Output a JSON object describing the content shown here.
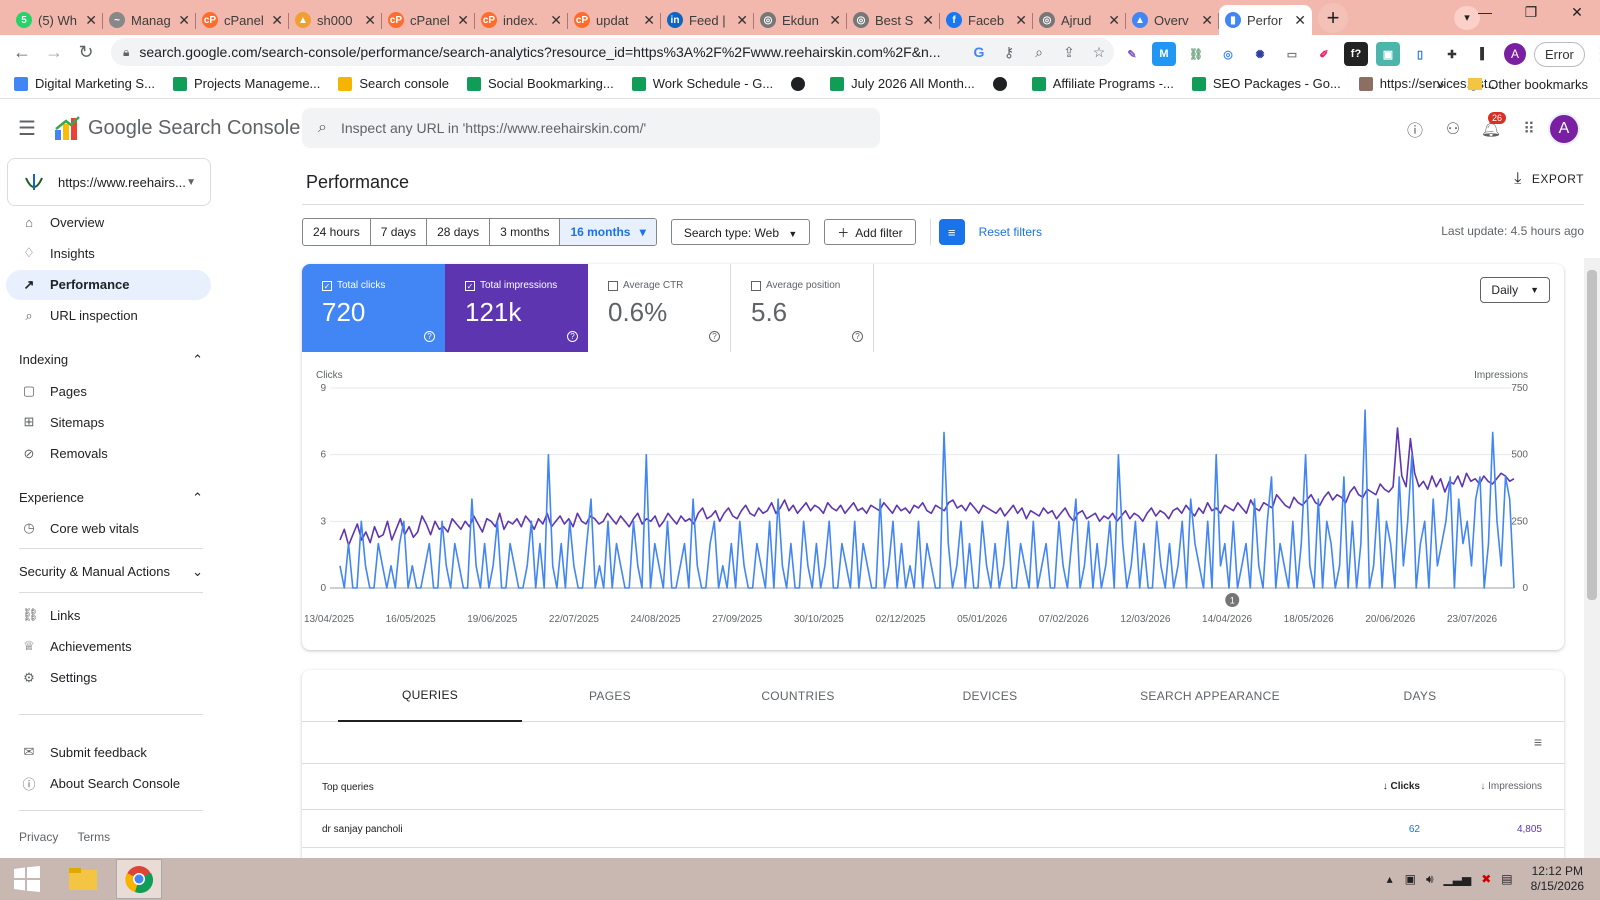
{
  "browser": {
    "tabs": [
      {
        "label": "(5) Wh",
        "color": "#25d366",
        "glyph": "5"
      },
      {
        "label": "Manag",
        "color": "#888888",
        "glyph": "~"
      },
      {
        "label": "cPanel",
        "color": "#ff6c2c",
        "glyph": "cP"
      },
      {
        "label": "sh000",
        "color": "#f0a030",
        "glyph": "▲"
      },
      {
        "label": "cPanel",
        "color": "#ff6c2c",
        "glyph": "cP"
      },
      {
        "label": "index.",
        "color": "#ff6c2c",
        "glyph": "cP"
      },
      {
        "label": "updat",
        "color": "#ff6c2c",
        "glyph": "cP"
      },
      {
        "label": "Feed |",
        "color": "#0a66c2",
        "glyph": "in"
      },
      {
        "label": "Ekdun",
        "color": "#777777",
        "glyph": "◎"
      },
      {
        "label": "Best S",
        "color": "#777777",
        "glyph": "◎"
      },
      {
        "label": "Faceb",
        "color": "#1877f2",
        "glyph": "f"
      },
      {
        "label": "Ajrud",
        "color": "#777777",
        "glyph": "◎"
      },
      {
        "label": "Overv",
        "color": "#4285f4",
        "glyph": "▲"
      },
      {
        "label": "Perfor",
        "color": "#4285f4",
        "glyph": "▮",
        "active": true
      }
    ],
    "url": "search.google.com/search-console/performance/search-analytics?resource_id=https%3A%2F%2Fwww.reehairskin.com%2F&n...",
    "error_label": "Error",
    "profile_letter": "A",
    "bookmarks": [
      {
        "label": "Digital Marketing S...",
        "color": "#4285f4"
      },
      {
        "label": "Projects Manageme...",
        "color": "#0f9d58"
      },
      {
        "label": "Search console",
        "color": "#f4b400"
      },
      {
        "label": "Social Bookmarking...",
        "color": "#0f9d58"
      },
      {
        "label": "Work Schedule - G...",
        "color": "#0f9d58"
      },
      {
        "label": "",
        "color": "#202124"
      },
      {
        "label": "July 2026 All Month...",
        "color": "#0f9d58"
      },
      {
        "label": "",
        "color": "#202124"
      },
      {
        "label": "Affiliate Programs -...",
        "color": "#0f9d58"
      },
      {
        "label": "SEO Packages - Go...",
        "color": "#0f9d58"
      },
      {
        "label": "https://services.gst...",
        "color": "#8d6e63"
      }
    ],
    "other_bookmarks": "Other bookmarks"
  },
  "app": {
    "name": "Google Search Console",
    "search_placeholder": "Inspect any URL in 'https://www.reehairskin.com/'",
    "notification_count": "26",
    "avatar_letter": "A"
  },
  "sidebar": {
    "property": "https://www.reehairs...",
    "items_top": [
      {
        "label": "Overview",
        "icon": "⌂"
      },
      {
        "label": "Insights",
        "icon": "♢"
      },
      {
        "label": "Performance",
        "icon": "↗",
        "active": true
      },
      {
        "label": "URL inspection",
        "icon": "⌕"
      }
    ],
    "indexing_label": "Indexing",
    "indexing_items": [
      {
        "label": "Pages",
        "icon": "▢"
      },
      {
        "label": "Sitemaps",
        "icon": "⊞"
      },
      {
        "label": "Removals",
        "icon": "⊘"
      }
    ],
    "experience_label": "Experience",
    "experience_items": [
      {
        "label": "Core web vitals",
        "icon": "◷"
      }
    ],
    "security_label": "Security & Manual Actions",
    "other_items": [
      {
        "label": "Links",
        "icon": "⛓"
      },
      {
        "label": "Achievements",
        "icon": "♕"
      },
      {
        "label": "Settings",
        "icon": "⚙"
      }
    ],
    "bottom_items": [
      {
        "label": "Submit feedback",
        "icon": "✉"
      },
      {
        "label": "About Search Console",
        "icon": "ⓘ"
      }
    ],
    "privacy": "Privacy",
    "terms": "Terms"
  },
  "performance": {
    "title": "Performance",
    "export": "EXPORT",
    "date_ranges": [
      "24 hours",
      "7 days",
      "28 days",
      "3 months",
      "16 months"
    ],
    "selected_range": "16 months",
    "search_type": "Search type: Web",
    "add_filter": "Add filter",
    "reset_filters": "Reset filters",
    "last_update": "Last update: 4.5 hours ago",
    "metrics": [
      {
        "label": "Total clicks",
        "value": "720",
        "checked": true
      },
      {
        "label": "Total impressions",
        "value": "121k",
        "checked": true
      },
      {
        "label": "Average CTR",
        "value": "0.6%",
        "checked": false
      },
      {
        "label": "Average position",
        "value": "5.6",
        "checked": false
      }
    ],
    "granularity": "Daily"
  },
  "chart_data": {
    "type": "line",
    "left_axis_label": "Clicks",
    "right_axis_label": "Impressions",
    "left_ticks": [
      "9",
      "6",
      "3",
      "0"
    ],
    "right_ticks": [
      "750",
      "500",
      "250",
      "0"
    ],
    "ylim_left": [
      0,
      9
    ],
    "ylim_right": [
      0,
      750
    ],
    "x_tick_labels": [
      "13/04/2025",
      "16/05/2025",
      "19/06/2025",
      "22/07/2025",
      "24/08/2025",
      "27/09/2025",
      "30/10/2025",
      "02/12/2025",
      "05/01/2026",
      "07/02/2026",
      "12/03/2026",
      "14/04/2026",
      "18/05/2026",
      "20/06/2026",
      "23/07/2026"
    ],
    "annotation_label": "1",
    "series": [
      {
        "name": "Clicks",
        "color": "#4285f4",
        "axis": "left",
        "values": [
          1,
          0,
          2,
          0,
          0,
          3,
          1,
          0,
          0,
          2,
          1,
          0,
          1,
          0,
          2,
          3,
          0,
          1,
          0,
          0,
          1,
          2,
          0,
          0,
          3,
          1,
          0,
          2,
          1,
          0,
          0,
          4,
          1,
          0,
          2,
          0,
          1,
          3,
          0,
          0,
          2,
          1,
          0,
          0,
          1,
          3,
          0,
          2,
          0,
          6,
          1,
          0,
          2,
          0,
          3,
          1,
          0,
          0,
          2,
          4,
          0,
          1,
          0,
          3,
          0,
          2,
          1,
          0,
          0,
          3,
          1,
          0,
          6,
          0,
          2,
          1,
          0,
          3,
          0,
          0,
          1,
          2,
          0,
          4,
          1,
          0,
          0,
          2,
          3,
          0,
          1,
          0,
          2,
          0,
          3,
          1,
          0,
          0,
          2,
          1,
          0,
          3,
          0,
          4,
          1,
          0,
          2,
          0,
          0,
          3,
          1,
          0,
          2,
          0,
          1,
          3,
          0,
          0,
          2,
          1,
          0,
          3,
          0,
          2,
          1,
          0,
          0,
          4,
          0,
          1,
          3,
          0,
          2,
          0,
          1,
          0,
          3,
          0,
          2,
          1,
          0,
          0,
          7,
          2,
          0,
          1,
          3,
          0,
          2,
          0,
          0,
          3,
          1,
          0,
          2,
          0,
          1,
          3,
          0,
          0,
          2,
          1,
          0,
          3,
          0,
          1,
          2,
          0,
          0,
          3,
          1,
          0,
          2,
          4,
          0,
          1,
          3,
          0,
          2,
          0,
          1,
          3,
          0,
          6,
          2,
          0,
          1,
          3,
          0,
          2,
          0,
          0,
          3,
          1,
          0,
          2,
          0,
          1,
          3,
          0,
          4,
          2,
          1,
          0,
          3,
          0,
          6,
          1,
          2,
          0,
          3,
          0,
          1,
          2,
          0,
          4,
          1,
          0,
          3,
          5,
          0,
          2,
          1,
          0,
          3,
          0,
          2,
          6,
          1,
          0,
          4,
          0,
          3,
          2,
          0,
          1,
          5,
          0,
          3,
          0,
          2,
          8,
          0,
          1,
          4,
          0,
          3,
          2,
          0,
          5,
          1,
          3,
          6,
          0,
          2,
          3,
          0,
          4,
          1,
          2,
          3,
          5,
          0,
          4,
          2,
          3,
          1,
          4,
          5,
          0,
          2,
          7,
          3,
          1,
          5,
          4,
          0
        ]
      },
      {
        "name": "Impressions",
        "color": "#5e35b1",
        "axis": "right",
        "values": [
          180,
          220,
          160,
          200,
          240,
          180,
          210,
          170,
          230,
          190,
          200,
          250,
          180,
          220,
          260,
          200,
          230,
          190,
          210,
          270,
          240,
          200,
          250,
          220,
          230,
          210,
          260,
          240,
          220,
          250,
          230,
          270,
          240,
          210,
          260,
          250,
          230,
          280,
          220,
          250,
          240,
          260,
          230,
          270,
          250,
          220,
          260,
          240,
          280,
          230,
          250,
          270,
          240,
          260,
          230,
          280,
          250,
          240,
          270,
          260,
          240,
          250,
          280,
          260,
          240,
          270,
          250,
          230,
          260,
          280,
          240,
          260,
          250,
          270,
          230,
          250,
          280,
          260,
          240,
          270,
          250,
          260,
          240,
          280,
          300,
          260,
          270,
          290,
          250,
          280,
          300,
          270,
          260,
          290,
          310,
          280,
          270,
          300,
          280,
          290,
          320,
          280,
          300,
          330,
          290,
          310,
          280,
          300,
          320,
          290,
          310,
          300,
          280,
          320,
          300,
          290,
          310,
          280,
          300,
          320,
          290,
          300,
          280,
          310,
          300,
          290,
          320,
          300,
          280,
          310,
          290,
          300,
          280,
          310,
          300,
          320,
          290,
          280,
          310,
          300,
          290,
          320,
          330,
          300,
          310,
          290,
          320,
          300,
          280,
          310,
          300,
          290,
          280,
          300,
          270,
          290,
          310,
          280,
          300,
          260,
          290,
          280,
          270,
          300,
          280,
          290,
          260,
          280,
          300,
          270,
          250,
          280,
          290,
          260,
          270,
          280,
          250,
          270,
          260,
          280,
          250,
          270,
          290,
          260,
          280,
          270,
          250,
          280,
          300,
          270,
          290,
          280,
          260,
          290,
          300,
          280,
          310,
          290,
          270,
          300,
          280,
          320,
          290,
          300,
          280,
          310,
          300,
          290,
          320,
          300,
          280,
          330,
          300,
          290,
          320,
          310,
          300,
          350,
          330,
          310,
          300,
          340,
          320,
          310,
          330,
          350,
          320,
          310,
          340,
          360,
          330,
          350,
          340,
          320,
          360,
          380,
          350,
          340,
          370,
          360,
          350,
          390,
          370,
          360,
          380,
          600,
          420,
          380,
          560,
          430,
          380,
          400,
          370,
          420,
          380,
          410,
          360,
          400,
          390,
          420,
          380,
          430,
          400,
          410,
          390,
          420,
          400,
          390,
          410,
          430,
          420,
          400,
          410
        ]
      }
    ]
  },
  "table": {
    "tabs": [
      "QUERIES",
      "PAGES",
      "COUNTRIES",
      "DEVICES",
      "SEARCH APPEARANCE",
      "DAYS"
    ],
    "header_left": "Top queries",
    "header_clicks": "Clicks",
    "header_impr": "Impressions",
    "rows": [
      {
        "query": "dr sanjay pancholi",
        "clicks": "62",
        "impressions": "4,805"
      }
    ]
  },
  "taskbar": {
    "time": "12:12 PM",
    "date": "8/15/2026"
  }
}
